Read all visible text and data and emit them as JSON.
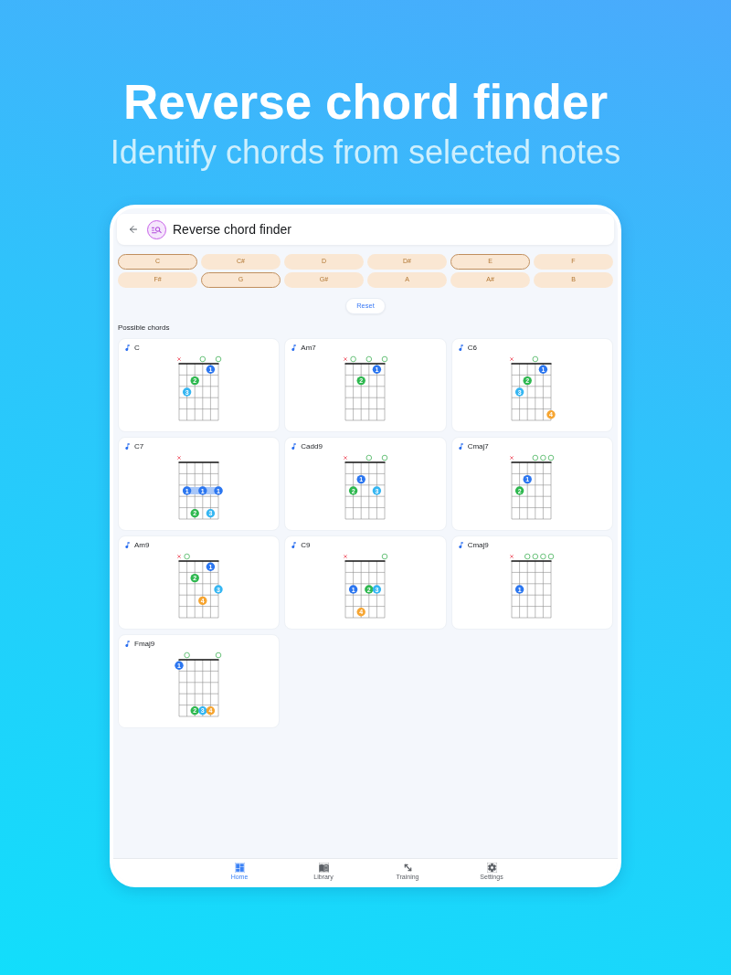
{
  "header": {
    "title": "Reverse chord finder",
    "subtitle": "Identify chords from selected notes"
  },
  "app_bar": {
    "title": "Reverse chord finder"
  },
  "notes": [
    {
      "label": "C",
      "selected": true
    },
    {
      "label": "C#",
      "selected": false
    },
    {
      "label": "D",
      "selected": false
    },
    {
      "label": "D#",
      "selected": false
    },
    {
      "label": "E",
      "selected": true
    },
    {
      "label": "F",
      "selected": false
    },
    {
      "label": "F#",
      "selected": false
    },
    {
      "label": "G",
      "selected": true
    },
    {
      "label": "G#",
      "selected": false
    },
    {
      "label": "A",
      "selected": false
    },
    {
      "label": "A#",
      "selected": false
    },
    {
      "label": "B",
      "selected": false
    }
  ],
  "reset_button": "Reset",
  "section_title": "Possible chords",
  "chords": [
    {
      "name": "C",
      "strings": [
        {
          "kind": "muted"
        },
        {
          "kind": "none"
        },
        {
          "kind": "none"
        },
        {
          "kind": "open"
        },
        {
          "kind": "none"
        },
        {
          "kind": "open"
        }
      ],
      "frets": [
        [
          {
            "kind": "empty"
          },
          {
            "kind": "empty"
          },
          {
            "kind": "empty"
          },
          {
            "kind": "empty"
          },
          {
            "kind": "dot",
            "finger": "1",
            "color": "#2b76f0"
          },
          {
            "kind": "empty"
          }
        ],
        [
          {
            "kind": "empty"
          },
          {
            "kind": "empty"
          },
          {
            "kind": "dot",
            "finger": "2",
            "color": "#2eb84f"
          },
          {
            "kind": "empty"
          },
          {
            "kind": "empty"
          },
          {
            "kind": "empty"
          }
        ],
        [
          {
            "kind": "empty"
          },
          {
            "kind": "dot",
            "finger": "3",
            "color": "#35b6f2"
          },
          {
            "kind": "empty"
          },
          {
            "kind": "empty"
          },
          {
            "kind": "empty"
          },
          {
            "kind": "empty"
          }
        ],
        [
          {
            "kind": "empty"
          },
          {
            "kind": "empty"
          },
          {
            "kind": "empty"
          },
          {
            "kind": "empty"
          },
          {
            "kind": "empty"
          },
          {
            "kind": "empty"
          }
        ],
        [
          {
            "kind": "empty"
          },
          {
            "kind": "empty"
          },
          {
            "kind": "empty"
          },
          {
            "kind": "empty"
          },
          {
            "kind": "empty"
          },
          {
            "kind": "empty"
          }
        ]
      ]
    },
    {
      "name": "Am7",
      "strings": [
        {
          "kind": "muted"
        },
        {
          "kind": "open"
        },
        {
          "kind": "none"
        },
        {
          "kind": "open"
        },
        {
          "kind": "none"
        },
        {
          "kind": "open"
        }
      ],
      "frets": [
        [
          {
            "kind": "empty"
          },
          {
            "kind": "empty"
          },
          {
            "kind": "empty"
          },
          {
            "kind": "empty"
          },
          {
            "kind": "dot",
            "finger": "1",
            "color": "#2b76f0"
          },
          {
            "kind": "empty"
          }
        ],
        [
          {
            "kind": "empty"
          },
          {
            "kind": "empty"
          },
          {
            "kind": "dot",
            "finger": "2",
            "color": "#2eb84f"
          },
          {
            "kind": "empty"
          },
          {
            "kind": "empty"
          },
          {
            "kind": "empty"
          }
        ],
        [
          {
            "kind": "empty"
          },
          {
            "kind": "empty"
          },
          {
            "kind": "empty"
          },
          {
            "kind": "empty"
          },
          {
            "kind": "empty"
          },
          {
            "kind": "empty"
          }
        ],
        [
          {
            "kind": "empty"
          },
          {
            "kind": "empty"
          },
          {
            "kind": "empty"
          },
          {
            "kind": "empty"
          },
          {
            "kind": "empty"
          },
          {
            "kind": "empty"
          }
        ],
        [
          {
            "kind": "empty"
          },
          {
            "kind": "empty"
          },
          {
            "kind": "empty"
          },
          {
            "kind": "empty"
          },
          {
            "kind": "empty"
          },
          {
            "kind": "empty"
          }
        ]
      ]
    },
    {
      "name": "C6",
      "strings": [
        {
          "kind": "muted"
        },
        {
          "kind": "none"
        },
        {
          "kind": "none"
        },
        {
          "kind": "open"
        },
        {
          "kind": "none"
        },
        {
          "kind": "none"
        }
      ],
      "frets": [
        [
          {
            "kind": "empty"
          },
          {
            "kind": "empty"
          },
          {
            "kind": "empty"
          },
          {
            "kind": "empty"
          },
          {
            "kind": "dot",
            "finger": "1",
            "color": "#2b76f0"
          },
          {
            "kind": "empty"
          }
        ],
        [
          {
            "kind": "empty"
          },
          {
            "kind": "empty"
          },
          {
            "kind": "dot",
            "finger": "2",
            "color": "#2eb84f"
          },
          {
            "kind": "empty"
          },
          {
            "kind": "empty"
          },
          {
            "kind": "empty"
          }
        ],
        [
          {
            "kind": "empty"
          },
          {
            "kind": "dot",
            "finger": "3",
            "color": "#35b6f2"
          },
          {
            "kind": "empty"
          },
          {
            "kind": "empty"
          },
          {
            "kind": "empty"
          },
          {
            "kind": "empty"
          }
        ],
        [
          {
            "kind": "empty"
          },
          {
            "kind": "empty"
          },
          {
            "kind": "empty"
          },
          {
            "kind": "empty"
          },
          {
            "kind": "empty"
          },
          {
            "kind": "empty"
          }
        ],
        [
          {
            "kind": "empty"
          },
          {
            "kind": "empty"
          },
          {
            "kind": "empty"
          },
          {
            "kind": "empty"
          },
          {
            "kind": "empty"
          },
          {
            "kind": "dot",
            "finger": "4",
            "color": "#f6a531"
          }
        ]
      ]
    },
    {
      "name": "C7",
      "strings": [
        {
          "kind": "muted"
        },
        {
          "kind": "none"
        },
        {
          "kind": "none"
        },
        {
          "kind": "none"
        },
        {
          "kind": "none"
        },
        {
          "kind": "none"
        }
      ],
      "frets": [
        [
          {
            "kind": "empty"
          },
          {
            "kind": "empty"
          },
          {
            "kind": "empty"
          },
          {
            "kind": "empty"
          },
          {
            "kind": "empty"
          },
          {
            "kind": "empty"
          }
        ],
        [
          {
            "kind": "empty"
          },
          {
            "kind": "empty"
          },
          {
            "kind": "empty"
          },
          {
            "kind": "empty"
          },
          {
            "kind": "empty"
          },
          {
            "kind": "empty"
          }
        ],
        [
          {
            "kind": "empty"
          },
          {
            "kind": "barre_dot",
            "finger": "1",
            "color": "#2b76f0"
          },
          {
            "kind": "barre"
          },
          {
            "kind": "barre_dot",
            "finger": "1",
            "color": "#2b76f0"
          },
          {
            "kind": "barre"
          },
          {
            "kind": "barre_dot",
            "finger": "1",
            "color": "#2b76f0"
          }
        ],
        [
          {
            "kind": "empty"
          },
          {
            "kind": "empty"
          },
          {
            "kind": "empty"
          },
          {
            "kind": "empty"
          },
          {
            "kind": "empty"
          },
          {
            "kind": "empty"
          }
        ],
        [
          {
            "kind": "empty"
          },
          {
            "kind": "empty"
          },
          {
            "kind": "dot",
            "finger": "2",
            "color": "#2eb84f"
          },
          {
            "kind": "empty"
          },
          {
            "kind": "dot",
            "finger": "3",
            "color": "#35b6f2"
          },
          {
            "kind": "empty"
          }
        ]
      ]
    },
    {
      "name": "Cadd9",
      "strings": [
        {
          "kind": "muted"
        },
        {
          "kind": "none"
        },
        {
          "kind": "none"
        },
        {
          "kind": "open"
        },
        {
          "kind": "none"
        },
        {
          "kind": "open"
        }
      ],
      "frets": [
        [
          {
            "kind": "empty"
          },
          {
            "kind": "empty"
          },
          {
            "kind": "empty"
          },
          {
            "kind": "empty"
          },
          {
            "kind": "empty"
          },
          {
            "kind": "empty"
          }
        ],
        [
          {
            "kind": "empty"
          },
          {
            "kind": "empty"
          },
          {
            "kind": "dot",
            "finger": "1",
            "color": "#2b76f0"
          },
          {
            "kind": "empty"
          },
          {
            "kind": "empty"
          },
          {
            "kind": "empty"
          }
        ],
        [
          {
            "kind": "empty"
          },
          {
            "kind": "dot",
            "finger": "2",
            "color": "#2eb84f"
          },
          {
            "kind": "empty"
          },
          {
            "kind": "empty"
          },
          {
            "kind": "dot",
            "finger": "3",
            "color": "#35b6f2"
          },
          {
            "kind": "empty"
          }
        ],
        [
          {
            "kind": "empty"
          },
          {
            "kind": "empty"
          },
          {
            "kind": "empty"
          },
          {
            "kind": "empty"
          },
          {
            "kind": "empty"
          },
          {
            "kind": "empty"
          }
        ],
        [
          {
            "kind": "empty"
          },
          {
            "kind": "empty"
          },
          {
            "kind": "empty"
          },
          {
            "kind": "empty"
          },
          {
            "kind": "empty"
          },
          {
            "kind": "empty"
          }
        ]
      ]
    },
    {
      "name": "Cmaj7",
      "strings": [
        {
          "kind": "muted"
        },
        {
          "kind": "none"
        },
        {
          "kind": "none"
        },
        {
          "kind": "open"
        },
        {
          "kind": "open"
        },
        {
          "kind": "open"
        }
      ],
      "frets": [
        [
          {
            "kind": "empty"
          },
          {
            "kind": "empty"
          },
          {
            "kind": "empty"
          },
          {
            "kind": "empty"
          },
          {
            "kind": "empty"
          },
          {
            "kind": "empty"
          }
        ],
        [
          {
            "kind": "empty"
          },
          {
            "kind": "empty"
          },
          {
            "kind": "dot",
            "finger": "1",
            "color": "#2b76f0"
          },
          {
            "kind": "empty"
          },
          {
            "kind": "empty"
          },
          {
            "kind": "empty"
          }
        ],
        [
          {
            "kind": "empty"
          },
          {
            "kind": "dot",
            "finger": "2",
            "color": "#2eb84f"
          },
          {
            "kind": "empty"
          },
          {
            "kind": "empty"
          },
          {
            "kind": "empty"
          },
          {
            "kind": "empty"
          }
        ],
        [
          {
            "kind": "empty"
          },
          {
            "kind": "empty"
          },
          {
            "kind": "empty"
          },
          {
            "kind": "empty"
          },
          {
            "kind": "empty"
          },
          {
            "kind": "empty"
          }
        ],
        [
          {
            "kind": "empty"
          },
          {
            "kind": "empty"
          },
          {
            "kind": "empty"
          },
          {
            "kind": "empty"
          },
          {
            "kind": "empty"
          },
          {
            "kind": "empty"
          }
        ]
      ]
    },
    {
      "name": "Am9",
      "strings": [
        {
          "kind": "muted"
        },
        {
          "kind": "open"
        },
        {
          "kind": "none"
        },
        {
          "kind": "none"
        },
        {
          "kind": "none"
        },
        {
          "kind": "none"
        }
      ],
      "frets": [
        [
          {
            "kind": "empty"
          },
          {
            "kind": "empty"
          },
          {
            "kind": "empty"
          },
          {
            "kind": "empty"
          },
          {
            "kind": "dot",
            "finger": "1",
            "color": "#2b76f0"
          },
          {
            "kind": "empty"
          }
        ],
        [
          {
            "kind": "empty"
          },
          {
            "kind": "empty"
          },
          {
            "kind": "dot",
            "finger": "2",
            "color": "#2eb84f"
          },
          {
            "kind": "empty"
          },
          {
            "kind": "empty"
          },
          {
            "kind": "empty"
          }
        ],
        [
          {
            "kind": "empty"
          },
          {
            "kind": "empty"
          },
          {
            "kind": "empty"
          },
          {
            "kind": "empty"
          },
          {
            "kind": "empty"
          },
          {
            "kind": "dot",
            "finger": "3",
            "color": "#35b6f2"
          }
        ],
        [
          {
            "kind": "empty"
          },
          {
            "kind": "empty"
          },
          {
            "kind": "empty"
          },
          {
            "kind": "dot",
            "finger": "4",
            "color": "#f6a531"
          },
          {
            "kind": "empty"
          },
          {
            "kind": "empty"
          }
        ],
        [
          {
            "kind": "empty"
          },
          {
            "kind": "empty"
          },
          {
            "kind": "empty"
          },
          {
            "kind": "empty"
          },
          {
            "kind": "empty"
          },
          {
            "kind": "empty"
          }
        ]
      ]
    },
    {
      "name": "C9",
      "strings": [
        {
          "kind": "muted"
        },
        {
          "kind": "none"
        },
        {
          "kind": "none"
        },
        {
          "kind": "none"
        },
        {
          "kind": "none"
        },
        {
          "kind": "open"
        }
      ],
      "frets": [
        [
          {
            "kind": "empty"
          },
          {
            "kind": "empty"
          },
          {
            "kind": "empty"
          },
          {
            "kind": "empty"
          },
          {
            "kind": "empty"
          },
          {
            "kind": "empty"
          }
        ],
        [
          {
            "kind": "empty"
          },
          {
            "kind": "empty"
          },
          {
            "kind": "empty"
          },
          {
            "kind": "empty"
          },
          {
            "kind": "empty"
          },
          {
            "kind": "empty"
          }
        ],
        [
          {
            "kind": "empty"
          },
          {
            "kind": "dot",
            "finger": "1",
            "color": "#2b76f0"
          },
          {
            "kind": "empty"
          },
          {
            "kind": "dot",
            "finger": "2",
            "color": "#2eb84f"
          },
          {
            "kind": "dot",
            "finger": "3",
            "color": "#35b6f2"
          },
          {
            "kind": "empty"
          }
        ],
        [
          {
            "kind": "empty"
          },
          {
            "kind": "empty"
          },
          {
            "kind": "empty"
          },
          {
            "kind": "empty"
          },
          {
            "kind": "empty"
          },
          {
            "kind": "empty"
          }
        ],
        [
          {
            "kind": "empty"
          },
          {
            "kind": "empty"
          },
          {
            "kind": "dot",
            "finger": "4",
            "color": "#f6a531"
          },
          {
            "kind": "empty"
          },
          {
            "kind": "empty"
          },
          {
            "kind": "empty"
          }
        ]
      ]
    },
    {
      "name": "Cmaj9",
      "strings": [
        {
          "kind": "muted"
        },
        {
          "kind": "none"
        },
        {
          "kind": "open"
        },
        {
          "kind": "open"
        },
        {
          "kind": "open"
        },
        {
          "kind": "open"
        }
      ],
      "frets": [
        [
          {
            "kind": "empty"
          },
          {
            "kind": "empty"
          },
          {
            "kind": "empty"
          },
          {
            "kind": "empty"
          },
          {
            "kind": "empty"
          },
          {
            "kind": "empty"
          }
        ],
        [
          {
            "kind": "empty"
          },
          {
            "kind": "empty"
          },
          {
            "kind": "empty"
          },
          {
            "kind": "empty"
          },
          {
            "kind": "empty"
          },
          {
            "kind": "empty"
          }
        ],
        [
          {
            "kind": "empty"
          },
          {
            "kind": "dot",
            "finger": "1",
            "color": "#2b76f0"
          },
          {
            "kind": "empty"
          },
          {
            "kind": "empty"
          },
          {
            "kind": "empty"
          },
          {
            "kind": "empty"
          }
        ],
        [
          {
            "kind": "empty"
          },
          {
            "kind": "empty"
          },
          {
            "kind": "empty"
          },
          {
            "kind": "empty"
          },
          {
            "kind": "empty"
          },
          {
            "kind": "empty"
          }
        ],
        [
          {
            "kind": "empty"
          },
          {
            "kind": "empty"
          },
          {
            "kind": "empty"
          },
          {
            "kind": "empty"
          },
          {
            "kind": "empty"
          },
          {
            "kind": "empty"
          }
        ]
      ]
    },
    {
      "name": "Fmaj9",
      "strings": [
        {
          "kind": "none"
        },
        {
          "kind": "open"
        },
        {
          "kind": "none"
        },
        {
          "kind": "none"
        },
        {
          "kind": "none"
        },
        {
          "kind": "open"
        }
      ],
      "frets": [
        [
          {
            "kind": "dot",
            "finger": "1",
            "color": "#2b76f0"
          },
          {
            "kind": "empty"
          },
          {
            "kind": "empty"
          },
          {
            "kind": "empty"
          },
          {
            "kind": "empty"
          },
          {
            "kind": "empty"
          }
        ],
        [
          {
            "kind": "empty"
          },
          {
            "kind": "empty"
          },
          {
            "kind": "empty"
          },
          {
            "kind": "empty"
          },
          {
            "kind": "empty"
          },
          {
            "kind": "empty"
          }
        ],
        [
          {
            "kind": "empty"
          },
          {
            "kind": "empty"
          },
          {
            "kind": "empty"
          },
          {
            "kind": "empty"
          },
          {
            "kind": "empty"
          },
          {
            "kind": "empty"
          }
        ],
        [
          {
            "kind": "empty"
          },
          {
            "kind": "empty"
          },
          {
            "kind": "empty"
          },
          {
            "kind": "empty"
          },
          {
            "kind": "empty"
          },
          {
            "kind": "empty"
          }
        ],
        [
          {
            "kind": "empty"
          },
          {
            "kind": "empty"
          },
          {
            "kind": "dot",
            "finger": "2",
            "color": "#2eb84f"
          },
          {
            "kind": "dot",
            "finger": "3",
            "color": "#35b6f2"
          },
          {
            "kind": "dot",
            "finger": "4",
            "color": "#f6a531"
          },
          {
            "kind": "empty"
          }
        ]
      ]
    }
  ],
  "bottom_nav": [
    {
      "label": "Home",
      "selected": true
    },
    {
      "label": "Library",
      "selected": false
    },
    {
      "label": "Training",
      "selected": false
    },
    {
      "label": "Settings",
      "selected": false
    }
  ]
}
